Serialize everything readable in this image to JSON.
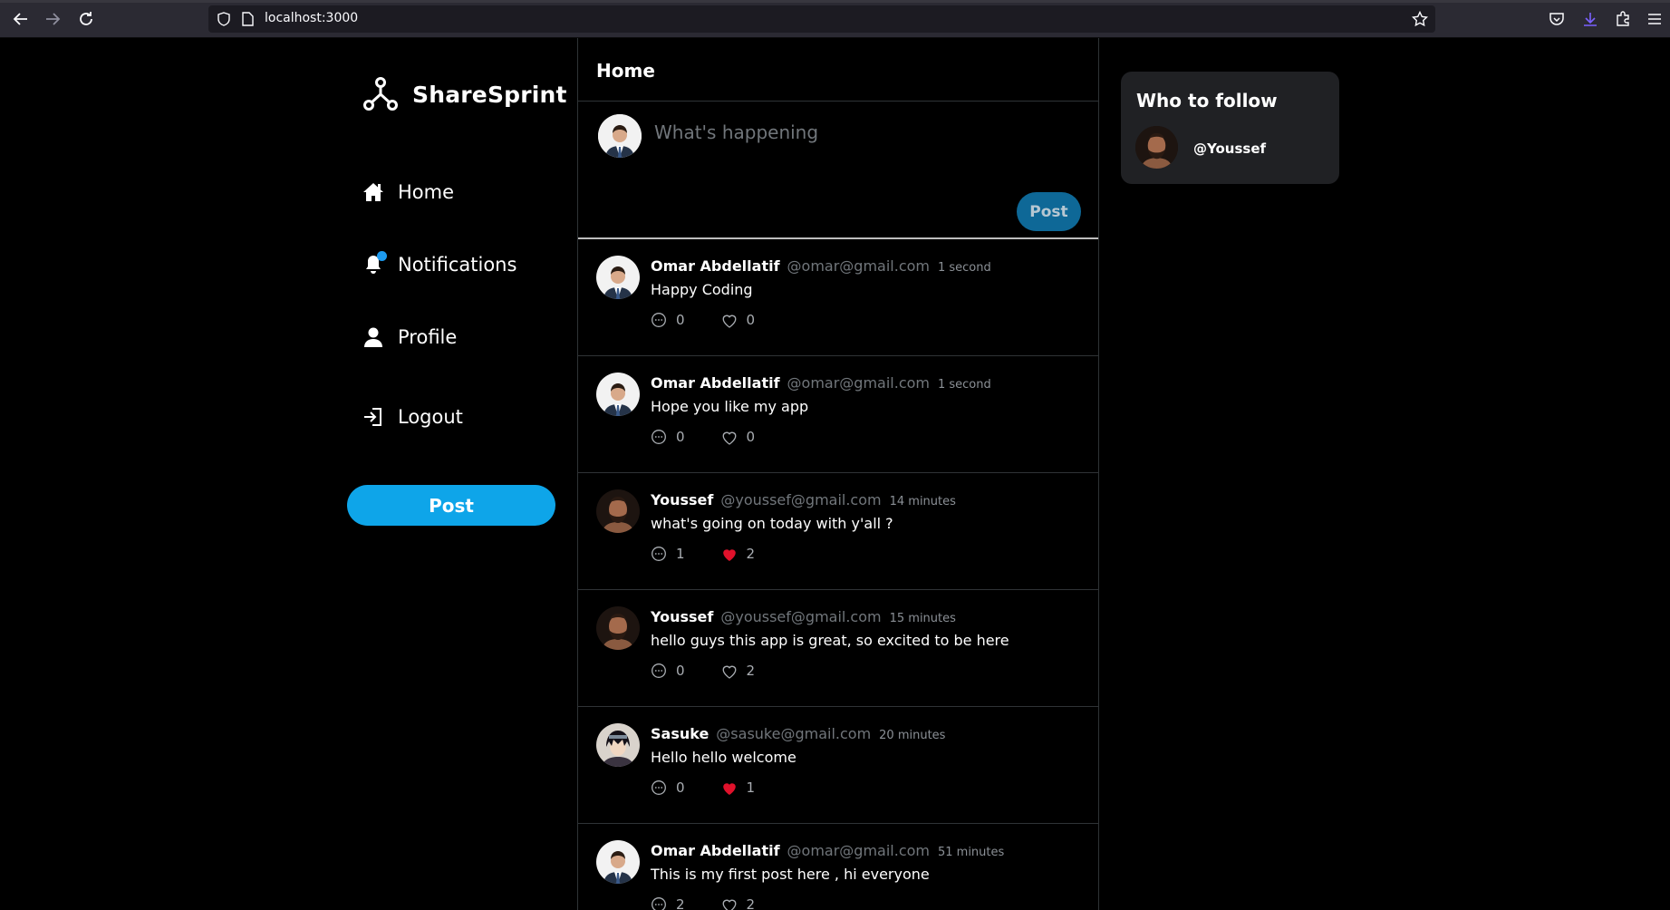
{
  "browser": {
    "url": "localhost:3000"
  },
  "app": {
    "name": "ShareSprint"
  },
  "nav": {
    "items": [
      {
        "label": "Home",
        "icon": "home-icon"
      },
      {
        "label": "Notifications",
        "icon": "bell-icon",
        "has_badge": true
      },
      {
        "label": "Profile",
        "icon": "user-icon"
      },
      {
        "label": "Logout",
        "icon": "logout-icon"
      }
    ],
    "post_button": "Post"
  },
  "feed": {
    "title": "Home",
    "composer": {
      "placeholder": "What's happening",
      "post_button": "Post"
    },
    "posts": [
      {
        "name": "Omar Abdellatif",
        "handle": "@omar@gmail.com",
        "time": "1 second",
        "body": "Happy Coding",
        "comments": "0",
        "likes": "0",
        "liked": false,
        "avatar": "omar"
      },
      {
        "name": "Omar Abdellatif",
        "handle": "@omar@gmail.com",
        "time": "1 second",
        "body": "Hope you like my app",
        "comments": "0",
        "likes": "0",
        "liked": false,
        "avatar": "omar"
      },
      {
        "name": "Youssef",
        "handle": "@youssef@gmail.com",
        "time": "14 minutes",
        "body": "what's going on today with y'all ?",
        "comments": "1",
        "likes": "2",
        "liked": true,
        "avatar": "youssef"
      },
      {
        "name": "Youssef",
        "handle": "@youssef@gmail.com",
        "time": "15 minutes",
        "body": "hello guys this app is great, so excited to be here",
        "comments": "0",
        "likes": "2",
        "liked": false,
        "avatar": "youssef"
      },
      {
        "name": "Sasuke",
        "handle": "@sasuke@gmail.com",
        "time": "20 minutes",
        "body": "Hello hello welcome",
        "comments": "0",
        "likes": "1",
        "liked": true,
        "avatar": "sasuke"
      },
      {
        "name": "Omar Abdellatif",
        "handle": "@omar@gmail.com",
        "time": "51 minutes",
        "body": "This is my first post here , hi everyone",
        "comments": "2",
        "likes": "2",
        "liked": false,
        "avatar": "omar"
      }
    ]
  },
  "sidebar_right": {
    "title": "Who to follow",
    "users": [
      {
        "handle": "@Youssef",
        "avatar": "youssef"
      }
    ]
  },
  "colors": {
    "accent": "#0ea5e9",
    "liked": "#e0112b",
    "background": "#000000",
    "muted": "#71767b"
  }
}
